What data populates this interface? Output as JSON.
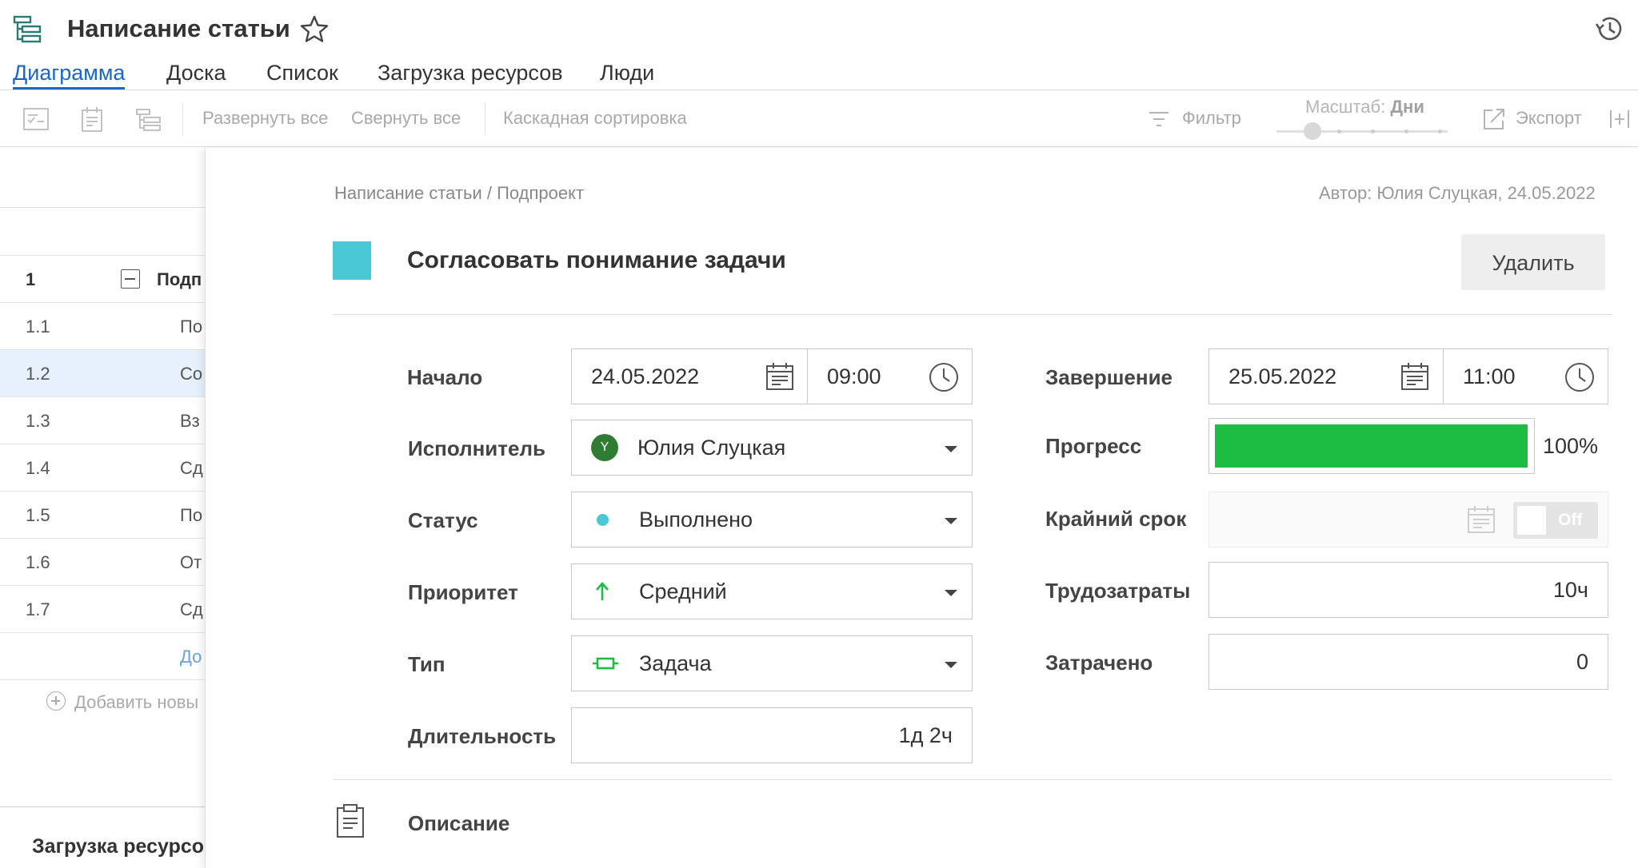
{
  "header": {
    "title": "Написание статьи",
    "tabs": [
      {
        "label": "Диаграмма",
        "active": true
      },
      {
        "label": "Доска",
        "active": false
      },
      {
        "label": "Список",
        "active": false
      },
      {
        "label": "Загрузка ресурсов",
        "active": false
      },
      {
        "label": "Люди",
        "active": false
      }
    ]
  },
  "toolbar": {
    "expand_all": "Развернуть все",
    "collapse_all": "Свернуть все",
    "cascade_sort": "Каскадная сортировка",
    "filter": "Фильтр",
    "scale_label": "Масштаб:",
    "scale_value": "Дни",
    "export": "Экспорт"
  },
  "left_panel": {
    "rows": [
      {
        "num": "1",
        "name": "Подп"
      },
      {
        "num": "1.1",
        "name": "По"
      },
      {
        "num": "1.2",
        "name": "Со"
      },
      {
        "num": "1.3",
        "name": "Вз"
      },
      {
        "num": "1.4",
        "name": "Сд"
      },
      {
        "num": "1.5",
        "name": "По"
      },
      {
        "num": "1.6",
        "name": "От"
      },
      {
        "num": "1.7",
        "name": "Сд"
      }
    ],
    "add_in_group": "До",
    "add_new": "Добавить новы",
    "resources_title": "Загрузка ресурсо"
  },
  "detail": {
    "breadcrumb": "Написание статьи / Подпроект",
    "author": "Автор: Юлия Слуцкая, 24.05.2022",
    "task_title": "Согласовать понимание задачи",
    "task_color": "#4bc8d6",
    "delete_label": "Удалить",
    "start_label": "Начало",
    "start_date": "24.05.2022",
    "start_time": "09:00",
    "assignee_label": "Исполнитель",
    "assignee_initial": "Y",
    "assignee_name": "Юлия Слуцкая",
    "status_label": "Статус",
    "status_value": "Выполнено",
    "status_color": "#4bc8d6",
    "priority_label": "Приоритет",
    "priority_value": "Средний",
    "type_label": "Тип",
    "type_value": "Задача",
    "duration_label": "Длительность",
    "duration_value": "1д 2ч",
    "end_label": "Завершение",
    "end_date": "25.05.2022",
    "end_time": "11:00",
    "progress_label": "Прогресс",
    "progress_value": "100%",
    "progress_fraction": 1.0,
    "progress_color": "#1dbc43",
    "deadline_label": "Крайний срок",
    "deadline_toggle": "Off",
    "effort_label": "Трудозатраты",
    "effort_value": "10ч",
    "spent_label": "Затрачено",
    "spent_value": "0",
    "description_label": "Описание"
  }
}
